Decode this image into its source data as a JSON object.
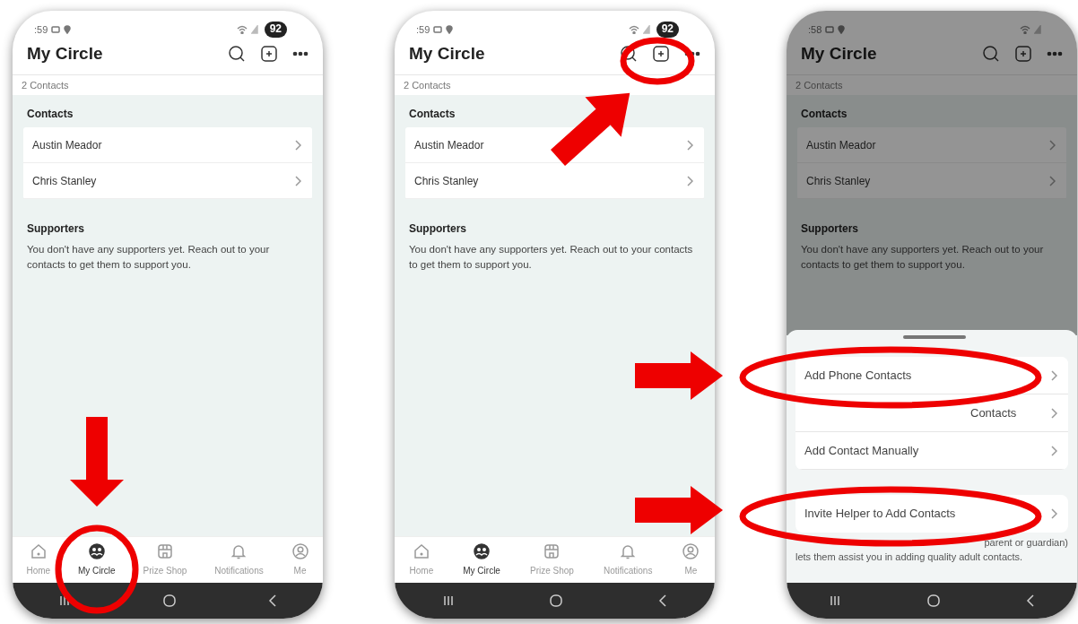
{
  "phones": [
    {
      "status_bar": {
        "time": ":59",
        "battery": "92"
      },
      "title": "My Circle",
      "contact_count": "2 Contacts",
      "contacts_heading": "Contacts",
      "contacts": [
        {
          "name": "Austin Meador"
        },
        {
          "name": "Chris Stanley"
        }
      ],
      "supporters_heading": "Supporters",
      "supporters_message": "You don't have any supporters yet. Reach out to your contacts to get them to support you.",
      "dimmed": false,
      "tabs": [
        {
          "label": "Home",
          "selected": false
        },
        {
          "label": "My Circle",
          "selected": true
        },
        {
          "label": "Prize Shop",
          "selected": false
        },
        {
          "label": "Notifications",
          "selected": false
        },
        {
          "label": "Me",
          "selected": false
        }
      ]
    },
    {
      "status_bar": {
        "time": ":59",
        "battery": "92"
      },
      "title": "My Circle",
      "contact_count": "2 Contacts",
      "contacts_heading": "Contacts",
      "contacts": [
        {
          "name": "Austin Meador"
        },
        {
          "name": "Chris Stanley"
        }
      ],
      "supporters_heading": "Supporters",
      "supporters_message": "You don't have any supporters yet. Reach out to your contacts to get them to support you.",
      "dimmed": false,
      "tabs": [
        {
          "label": "Home",
          "selected": false
        },
        {
          "label": "My Circle",
          "selected": true
        },
        {
          "label": "Prize Shop",
          "selected": false
        },
        {
          "label": "Notifications",
          "selected": false
        },
        {
          "label": "Me",
          "selected": false
        }
      ]
    },
    {
      "status_bar": {
        "time": ":58"
      },
      "title": "My Circle",
      "contact_count": "2 Contacts",
      "contacts_heading": "Contacts",
      "contacts": [
        {
          "name": "Austin Meador"
        },
        {
          "name": "Chris Stanley"
        }
      ],
      "supporters_heading": "Supporters",
      "supporters_message": "You don't have any supporters yet. Reach out to your contacts to get them to support you.",
      "dimmed": true,
      "sheet": {
        "options": [
          {
            "label": "Add Phone Contacts",
            "kind": "full"
          },
          {
            "label": "Contacts",
            "kind": "obscured"
          },
          {
            "label": "Add Contact Manually",
            "kind": "full"
          }
        ],
        "helper_option": {
          "label": "Invite Helper to Add Contacts"
        },
        "helper_note": [
          "parent or guardian)",
          "lets them assist you in adding quality adult contacts."
        ]
      }
    }
  ]
}
